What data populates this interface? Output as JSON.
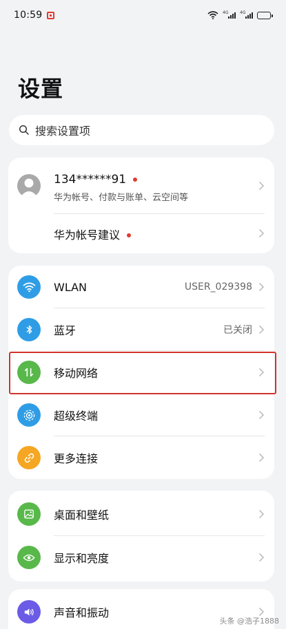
{
  "status_bar": {
    "time": "10:59",
    "signal_tag_1": "4G",
    "signal_tag_2": "4G"
  },
  "page": {
    "title": "设置"
  },
  "search": {
    "placeholder": "搜索设置项"
  },
  "account": {
    "phone": "134******91",
    "subtitle": "华为帐号、付款与账单、云空间等",
    "suggestion_label": "华为帐号建议"
  },
  "connectivity": {
    "items": [
      {
        "label": "WLAN",
        "value": "USER_029398",
        "icon": "wifi-icon",
        "color": "#2f9de6"
      },
      {
        "label": "蓝牙",
        "value": "已关闭",
        "icon": "bluetooth-icon",
        "color": "#2f9de6"
      },
      {
        "label": "移动网络",
        "value": "",
        "icon": "mobile-data-icon",
        "color": "#58b84a"
      },
      {
        "label": "超级终端",
        "value": "",
        "icon": "super-device-icon",
        "color": "#2f9de6"
      },
      {
        "label": "更多连接",
        "value": "",
        "icon": "link-icon",
        "color": "#f5a623"
      }
    ]
  },
  "display": {
    "items": [
      {
        "label": "桌面和壁纸",
        "icon": "wallpaper-icon",
        "color": "#58b84a"
      },
      {
        "label": "显示和亮度",
        "icon": "eye-icon",
        "color": "#58b84a"
      }
    ]
  },
  "sound": {
    "items": [
      {
        "label": "声音和振动",
        "icon": "speaker-icon",
        "color": "#6b5be6"
      }
    ]
  },
  "watermark": "头条 @浩子1888"
}
